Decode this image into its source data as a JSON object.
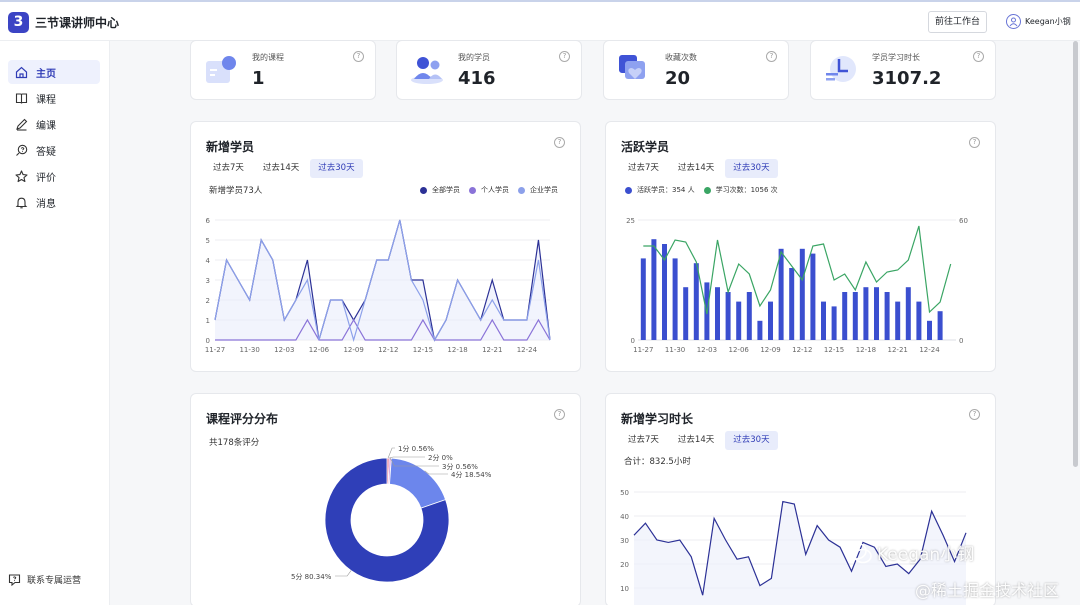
{
  "app": {
    "title": "三节课讲师中心",
    "logo_text": "3"
  },
  "header": {
    "workbench_label": "前往工作台",
    "user_name": "Keegan小钢"
  },
  "sidebar": {
    "items": [
      {
        "label": "主页",
        "icon": "home-icon"
      },
      {
        "label": "课程",
        "icon": "book-icon"
      },
      {
        "label": "编课",
        "icon": "pen-icon"
      },
      {
        "label": "答疑",
        "icon": "qa-icon"
      },
      {
        "label": "评价",
        "icon": "star-icon"
      },
      {
        "label": "消息",
        "icon": "bell-icon"
      }
    ],
    "active_index": 0,
    "contact_label": "联系专属运营"
  },
  "stats": [
    {
      "label": "我的课程",
      "value": "1"
    },
    {
      "label": "我的学员",
      "value": "416"
    },
    {
      "label": "收藏次数",
      "value": "20"
    },
    {
      "label": "学员学习时长",
      "value": "3107.2"
    }
  ],
  "tabs": [
    "过去7天",
    "过去14天",
    "过去30天"
  ],
  "colors": {
    "accent": "#303cb6",
    "all": "#2c3196",
    "personal": "#8a73d8",
    "enterprise": "#8ca0ea",
    "active_bar": "#3b4fcf",
    "study_line": "#3aa564",
    "donut": "#2f3fb8"
  },
  "new_students": {
    "title": "新增学员",
    "active_tab": 2,
    "summary": "新增学员73人",
    "chart_data": {
      "type": "line",
      "x": [
        "11-27",
        "11-28",
        "11-29",
        "11-30",
        "12-01",
        "12-02",
        "12-03",
        "12-04",
        "12-05",
        "12-06",
        "12-07",
        "12-08",
        "12-09",
        "12-10",
        "12-11",
        "12-12",
        "12-13",
        "12-14",
        "12-15",
        "12-16",
        "12-17",
        "12-18",
        "12-19",
        "12-20",
        "12-21",
        "12-22",
        "12-23",
        "12-24",
        "12-25",
        "12-26"
      ],
      "x_ticks": [
        "11-27",
        "11-30",
        "12-03",
        "12-06",
        "12-09",
        "12-12",
        "12-15",
        "12-18",
        "12-21",
        "12-24"
      ],
      "ylim": [
        0,
        6
      ],
      "y_ticks": [
        0,
        1,
        2,
        3,
        4,
        5,
        6
      ],
      "series": [
        {
          "name": "全部学员",
          "values": [
            1,
            4,
            3,
            2,
            5,
            4,
            1,
            2,
            4,
            0,
            2,
            2,
            1,
            2,
            4,
            4,
            6,
            3,
            3,
            0,
            1,
            3,
            2,
            1,
            3,
            1,
            1,
            1,
            5,
            0
          ]
        },
        {
          "name": "个人学员",
          "values": [
            0,
            0,
            0,
            0,
            0,
            0,
            0,
            0,
            1,
            0,
            0,
            0,
            1,
            0,
            0,
            0,
            0,
            0,
            1,
            0,
            0,
            0,
            0,
            0,
            1,
            0,
            0,
            0,
            1,
            0
          ]
        },
        {
          "name": "企业学员",
          "values": [
            1,
            4,
            3,
            2,
            5,
            4,
            1,
            2,
            3,
            0,
            2,
            2,
            0,
            2,
            4,
            4,
            6,
            3,
            2,
            0,
            1,
            3,
            2,
            1,
            2,
            1,
            1,
            1,
            4,
            0
          ]
        }
      ]
    }
  },
  "active_students": {
    "title": "活跃学员",
    "active_tab": 2,
    "legend": [
      "活跃学员：354 人",
      "学习次数：1056 次"
    ],
    "chart_data": {
      "type": "bar",
      "x": [
        "11-27",
        "11-28",
        "11-29",
        "11-30",
        "12-01",
        "12-02",
        "12-03",
        "12-04",
        "12-05",
        "12-06",
        "12-07",
        "12-08",
        "12-09",
        "12-10",
        "12-11",
        "12-12",
        "12-13",
        "12-14",
        "12-15",
        "12-16",
        "12-17",
        "12-18",
        "12-19",
        "12-20",
        "12-21",
        "12-22",
        "12-23",
        "12-24",
        "12-25",
        "12-26"
      ],
      "x_ticks": [
        "11-27",
        "11-30",
        "12-03",
        "12-06",
        "12-09",
        "12-12",
        "12-15",
        "12-18",
        "12-21",
        "12-24"
      ],
      "ylim_left": [
        0,
        25
      ],
      "ylim_right": [
        0,
        60
      ],
      "y_ticks_left": [
        0,
        25
      ],
      "y_ticks_right": [
        0,
        60
      ],
      "series": [
        {
          "name": "活跃学员",
          "values": [
            17,
            21,
            20,
            17,
            11,
            16,
            12,
            11,
            10,
            8,
            10,
            4,
            8,
            19,
            15,
            19,
            18,
            8,
            7,
            10,
            10,
            11,
            11,
            10,
            8,
            11,
            8,
            4,
            6,
            0
          ]
        },
        {
          "name": "学习次数",
          "values": [
            47,
            47,
            40,
            50,
            49,
            39,
            13,
            50,
            24,
            38,
            33,
            17,
            25,
            44,
            37,
            30,
            47,
            48,
            30,
            33,
            25,
            39,
            29,
            34,
            35,
            40,
            57,
            14,
            19,
            38
          ]
        }
      ]
    }
  },
  "ratings": {
    "title": "课程评分分布",
    "summary": "共178条评分",
    "chart_data": {
      "type": "pie",
      "labels": [
        "1分 0.56%",
        "2分 0%",
        "3分 0.56%",
        "4分 18.54%",
        "5分 80.34%"
      ],
      "values": [
        0.56,
        0,
        0.56,
        18.54,
        80.34
      ]
    }
  },
  "study_time": {
    "title": "新增学习时长",
    "active_tab": 2,
    "summary": "合计：832.5小时",
    "chart_data": {
      "type": "line",
      "ylim": [
        10,
        50
      ],
      "y_ticks": [
        10,
        20,
        30,
        40,
        50
      ],
      "series": [
        {
          "name": "学习时长",
          "values": [
            32,
            37,
            30,
            29,
            30,
            23,
            7,
            39,
            30,
            22,
            23,
            11,
            14,
            46,
            45,
            24,
            36,
            30,
            27,
            17,
            29,
            27,
            19,
            20,
            16,
            22,
            42,
            32,
            21,
            33
          ]
        }
      ]
    }
  },
  "watermark": {
    "line1": "Keegan小钢",
    "line2": "@稀土掘金技术社区"
  }
}
